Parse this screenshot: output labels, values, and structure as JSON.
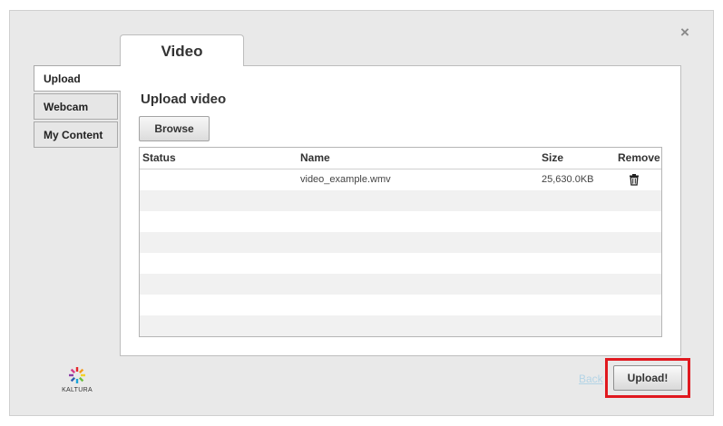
{
  "dialog": {
    "close_symbol": "×"
  },
  "top_tab": {
    "label": "Video"
  },
  "side_tabs": [
    {
      "label": "Upload",
      "active": true
    },
    {
      "label": "Webcam",
      "active": false
    },
    {
      "label": "My Content",
      "active": false
    }
  ],
  "upload": {
    "heading": "Upload video",
    "browse_label": "Browse"
  },
  "table": {
    "columns": [
      "Status",
      "Name",
      "Size",
      "Remove"
    ],
    "rows": [
      {
        "status": "",
        "name": "video_example.wmv",
        "size": "25,630.0KB",
        "remove_icon": "trash-icon"
      }
    ]
  },
  "footer": {
    "logo_text": "KALTURA",
    "back_label": "Back",
    "upload_label": "Upload!"
  },
  "colors": {
    "highlight": "#e0191f",
    "back_link": "#b3d4e6"
  }
}
